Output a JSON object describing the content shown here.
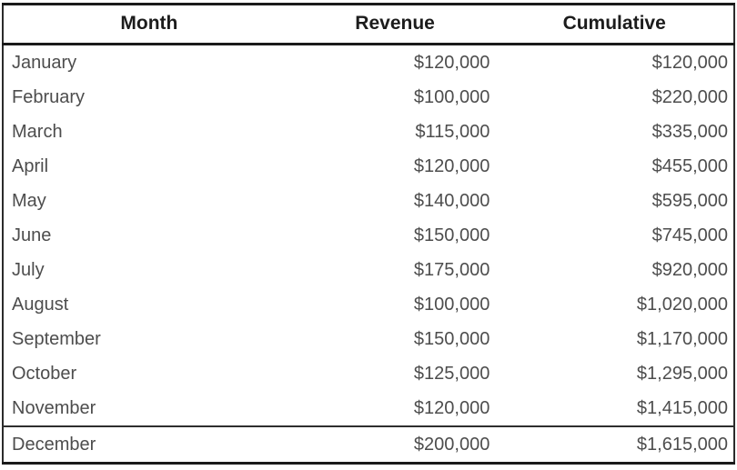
{
  "table": {
    "columns": [
      {
        "key": "month",
        "label": "Month",
        "align": "left"
      },
      {
        "key": "revenue",
        "label": "Revenue",
        "align": "right"
      },
      {
        "key": "cumulative",
        "label": "Cumulative",
        "align": "right"
      }
    ],
    "rows": [
      {
        "month": "January",
        "revenue": "$120,000",
        "cumulative": "$120,000"
      },
      {
        "month": "February",
        "revenue": "$100,000",
        "cumulative": "$220,000"
      },
      {
        "month": "March",
        "revenue": "$115,000",
        "cumulative": "$335,000"
      },
      {
        "month": "April",
        "revenue": "$120,000",
        "cumulative": "$455,000"
      },
      {
        "month": "May",
        "revenue": "$140,000",
        "cumulative": "$595,000"
      },
      {
        "month": "June",
        "revenue": "$150,000",
        "cumulative": "$745,000"
      },
      {
        "month": "July",
        "revenue": "$175,000",
        "cumulative": "$920,000"
      },
      {
        "month": "August",
        "revenue": "$100,000",
        "cumulative": "$1,020,000"
      },
      {
        "month": "September",
        "revenue": "$150,000",
        "cumulative": "$1,170,000"
      },
      {
        "month": "October",
        "revenue": "$125,000",
        "cumulative": "$1,295,000"
      },
      {
        "month": "November",
        "revenue": "$120,000",
        "cumulative": "$1,415,000"
      },
      {
        "month": "December",
        "revenue": "$200,000",
        "cumulative": "$1,615,000"
      }
    ]
  },
  "chart_data": {
    "type": "table",
    "title": "",
    "columns": [
      "Month",
      "Revenue",
      "Cumulative"
    ],
    "categories": [
      "January",
      "February",
      "March",
      "April",
      "May",
      "June",
      "July",
      "August",
      "September",
      "October",
      "November",
      "December"
    ],
    "series": [
      {
        "name": "Revenue",
        "values": [
          120000,
          100000,
          115000,
          120000,
          140000,
          150000,
          175000,
          100000,
          150000,
          125000,
          120000,
          200000
        ]
      },
      {
        "name": "Cumulative",
        "values": [
          120000,
          220000,
          335000,
          455000,
          595000,
          745000,
          920000,
          1020000,
          1170000,
          1295000,
          1415000,
          1615000
        ]
      }
    ],
    "xlabel": "Month",
    "ylabel": "",
    "currency": "USD",
    "grid": false
  },
  "colors": {
    "header_text": "#1c1c1c",
    "body_text": "#4d4d4d",
    "rule": "#1a1a1a",
    "background": "#ffffff"
  }
}
